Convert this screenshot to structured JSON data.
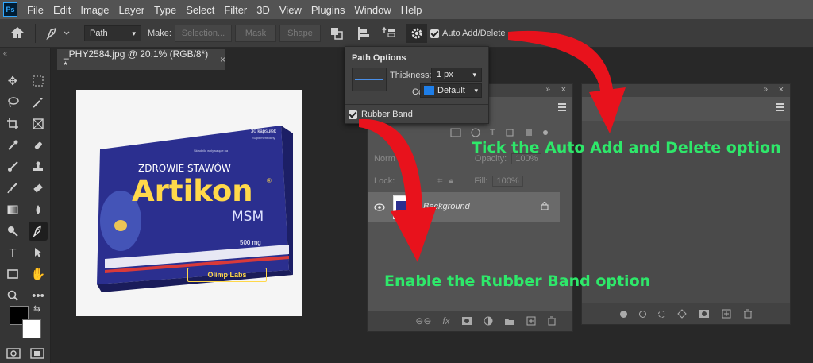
{
  "app": {
    "logo": "Ps"
  },
  "menu": [
    "File",
    "Edit",
    "Image",
    "Layer",
    "Type",
    "Select",
    "Filter",
    "3D",
    "View",
    "Plugins",
    "Window",
    "Help"
  ],
  "options_bar": {
    "mode_value": "Path",
    "make_label": "Make:",
    "selection_button": "Selection...",
    "mask_button": "Mask",
    "shape_button": "Shape",
    "auto_add_delete_label": "Auto Add/Delete"
  },
  "document_tab": {
    "title": "_PHY2584.jpg @ 20.1% (RGB/8*) *",
    "close_symbol": "×"
  },
  "path_options": {
    "title": "Path Options",
    "thickness_label": "Thickness:",
    "thickness_value": "1 px",
    "color_label": "Color:",
    "color_value": "Default",
    "color_swatch": "#1e7ee8",
    "rubber_band_label": "Rubber Band"
  },
  "layers_panel": {
    "normal_label": "Norm",
    "opacity_label": "Opacity:",
    "opacity_value": "100%",
    "lock_label": "Lock:",
    "fill_label": "Fill:",
    "fill_value": "100%",
    "layer_name": "Background"
  },
  "product": {
    "count": "30 kapsułek",
    "supplement": "Suplement diety",
    "ingredients_note": "Składniki wpływające na",
    "line": "ZDROWIE STAWÓW",
    "brand": "Artikon",
    "registered": "®",
    "sub": "MSM",
    "dose": "500 mg",
    "maker": "Olimp Labs"
  },
  "annotations": {
    "auto_add": "Tick the Auto Add and Delete option",
    "rubber_band": "Enable the Rubber Band option"
  },
  "colors": {
    "arrow": "#e8121c",
    "annotation": "#2ee86a",
    "box_blue": "#2b2f8f"
  }
}
